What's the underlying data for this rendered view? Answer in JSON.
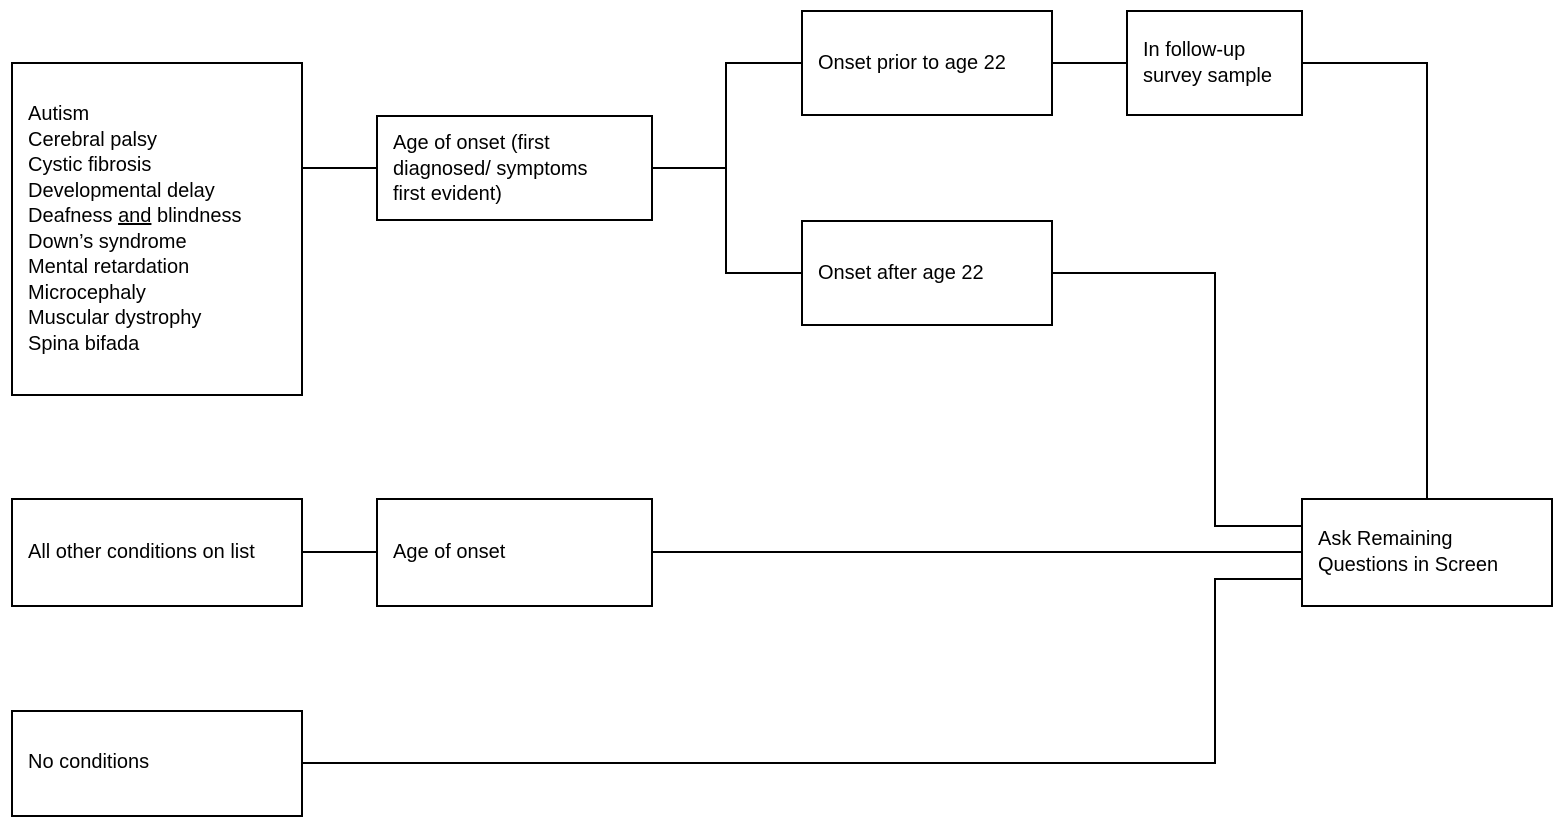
{
  "diagram": {
    "conditions_box": {
      "items": [
        {
          "before": "Autism",
          "underlined": "",
          "after": ""
        },
        {
          "before": "Cerebral palsy",
          "underlined": "",
          "after": ""
        },
        {
          "before": "Cystic fibrosis",
          "underlined": "",
          "after": ""
        },
        {
          "before": "Developmental delay",
          "underlined": "",
          "after": ""
        },
        {
          "before": "Deafness ",
          "underlined": "and",
          "after": " blindness"
        },
        {
          "before": "Down’s syndrome",
          "underlined": "",
          "after": ""
        },
        {
          "before": "Mental retardation",
          "underlined": "",
          "after": ""
        },
        {
          "before": "Microcephaly",
          "underlined": "",
          "after": ""
        },
        {
          "before": "Muscular dystrophy",
          "underlined": "",
          "after": ""
        },
        {
          "before": "Spina bifada",
          "underlined": "",
          "after": ""
        }
      ]
    },
    "age_of_onset_detailed": {
      "lines": [
        "Age of onset (first",
        "diagnosed/ symptoms",
        "first evident)"
      ]
    },
    "onset_prior": {
      "label": "Onset prior to age 22"
    },
    "onset_after": {
      "label": "Onset after age 22"
    },
    "follow_up": {
      "lines": [
        "In follow-up",
        "survey sample"
      ]
    },
    "other_conditions": {
      "label": "All other conditions on list"
    },
    "age_of_onset_simple": {
      "label": "Age of onset"
    },
    "no_conditions": {
      "label": "No conditions"
    },
    "ask_remaining": {
      "lines": [
        "Ask Remaining",
        "Questions in Screen"
      ]
    }
  }
}
